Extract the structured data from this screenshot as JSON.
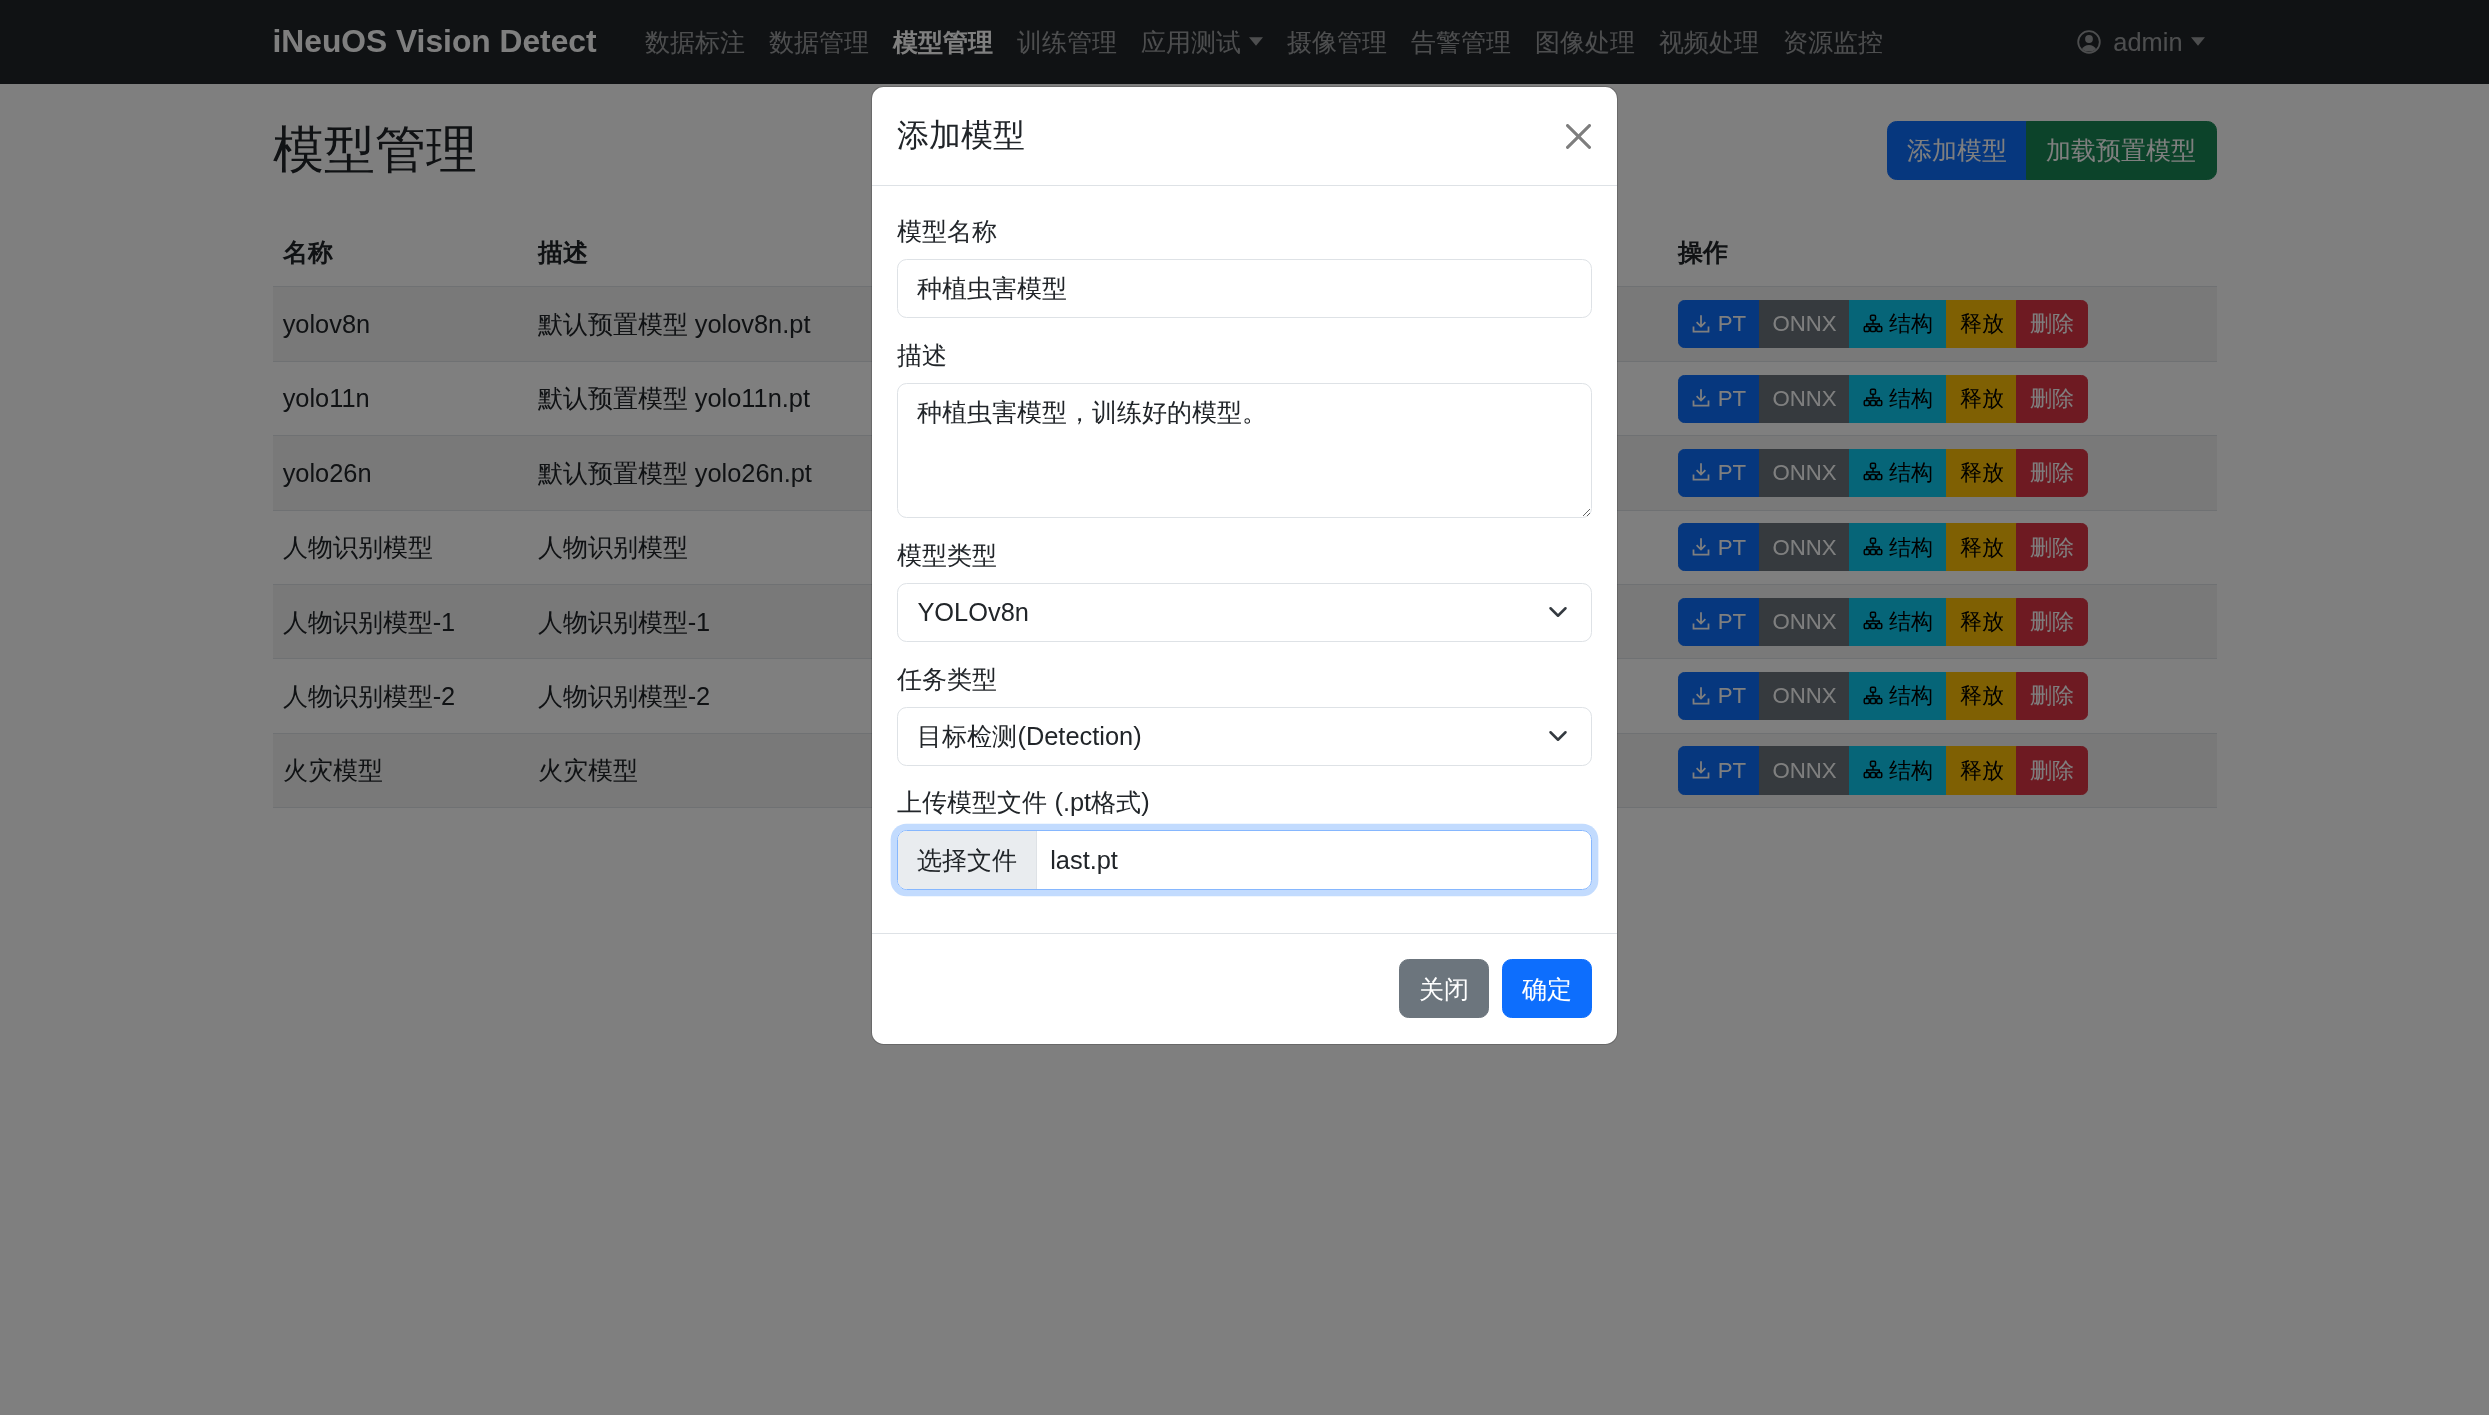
{
  "navbar": {
    "brand": "iNeuOS Vision Detect",
    "items": [
      {
        "label": "数据标注",
        "selected": false,
        "dropdown": false
      },
      {
        "label": "数据管理",
        "selected": false,
        "dropdown": false
      },
      {
        "label": "模型管理",
        "selected": true,
        "dropdown": false
      },
      {
        "label": "训练管理",
        "selected": false,
        "dropdown": false
      },
      {
        "label": "应用测试",
        "selected": false,
        "dropdown": true
      },
      {
        "label": "摄像管理",
        "selected": false,
        "dropdown": false
      },
      {
        "label": "告警管理",
        "selected": false,
        "dropdown": false
      },
      {
        "label": "图像处理",
        "selected": false,
        "dropdown": false
      },
      {
        "label": "视频处理",
        "selected": false,
        "dropdown": false
      },
      {
        "label": "资源监控",
        "selected": false,
        "dropdown": false
      }
    ],
    "user": {
      "label": "admin"
    }
  },
  "page": {
    "title": "模型管理",
    "buttons": [
      {
        "label": "添加模型",
        "kind": "primary"
      },
      {
        "label": "加载预置模型",
        "kind": "success"
      }
    ]
  },
  "table": {
    "columns": [
      "名称",
      "描述",
      "操作"
    ],
    "rows": [
      {
        "name": "yolov8n",
        "description": "默认预置模型 yolov8n.pt",
        "actions": [
          {
            "label": "PT",
            "kind": "primary"
          },
          {
            "label": "ONNX",
            "kind": "secondary"
          },
          {
            "label": "结构",
            "kind": "info"
          },
          {
            "label": "释放",
            "kind": "warning"
          },
          {
            "label": "删除",
            "kind": "danger"
          }
        ]
      },
      {
        "name": "yolo11n",
        "description": "默认预置模型 yolo11n.pt",
        "actions": [
          {
            "label": "PT",
            "kind": "primary"
          },
          {
            "label": "ONNX",
            "kind": "secondary"
          },
          {
            "label": "结构",
            "kind": "info"
          },
          {
            "label": "释放",
            "kind": "warning"
          },
          {
            "label": "删除",
            "kind": "danger"
          }
        ]
      },
      {
        "name": "yolo26n",
        "description": "默认预置模型 yolo26n.pt",
        "actions": [
          {
            "label": "PT",
            "kind": "primary"
          },
          {
            "label": "ONNX",
            "kind": "secondary"
          },
          {
            "label": "结构",
            "kind": "info"
          },
          {
            "label": "释放",
            "kind": "warning"
          },
          {
            "label": "删除",
            "kind": "danger"
          }
        ]
      },
      {
        "name": "人物识别模型",
        "description": "人物识别模型",
        "actions": [
          {
            "label": "PT",
            "kind": "primary"
          },
          {
            "label": "ONNX",
            "kind": "secondary"
          },
          {
            "label": "结构",
            "kind": "info"
          },
          {
            "label": "释放",
            "kind": "warning"
          },
          {
            "label": "删除",
            "kind": "danger"
          }
        ]
      },
      {
        "name": "人物识别模型-1",
        "description": "人物识别模型-1",
        "actions": [
          {
            "label": "PT",
            "kind": "primary"
          },
          {
            "label": "ONNX",
            "kind": "secondary"
          },
          {
            "label": "结构",
            "kind": "info"
          },
          {
            "label": "释放",
            "kind": "warning"
          },
          {
            "label": "删除",
            "kind": "danger"
          }
        ]
      },
      {
        "name": "人物识别模型-2",
        "description": "人物识别模型-2",
        "actions": [
          {
            "label": "PT",
            "kind": "primary"
          },
          {
            "label": "ONNX",
            "kind": "secondary"
          },
          {
            "label": "结构",
            "kind": "info"
          },
          {
            "label": "释放",
            "kind": "warning"
          },
          {
            "label": "删除",
            "kind": "danger"
          }
        ]
      },
      {
        "name": "火灾模型",
        "description": "火灾模型",
        "actions": [
          {
            "label": "PT",
            "kind": "primary"
          },
          {
            "label": "ONNX",
            "kind": "secondary"
          },
          {
            "label": "结构",
            "kind": "info"
          },
          {
            "label": "释放",
            "kind": "warning"
          },
          {
            "label": "删除",
            "kind": "danger"
          }
        ]
      }
    ]
  },
  "modal": {
    "title": "添加模型",
    "fields": [
      {
        "kind": "input",
        "label": "模型名称",
        "value": "种植虫害模型"
      },
      {
        "kind": "textarea",
        "label": "描述",
        "value": "种植虫害模型，训练好的模型。"
      },
      {
        "kind": "select",
        "label": "模型类型",
        "value": "YOLOv8n"
      },
      {
        "kind": "select",
        "label": "任务类型",
        "value": "目标检测(Detection)"
      },
      {
        "kind": "file",
        "label": "上传模型文件 (.pt格式)",
        "button": "选择文件",
        "value": "last.pt",
        "focused": true
      }
    ],
    "buttons": [
      {
        "label": "关闭",
        "kind": "secondary"
      },
      {
        "label": "确定",
        "kind": "primary"
      }
    ]
  }
}
